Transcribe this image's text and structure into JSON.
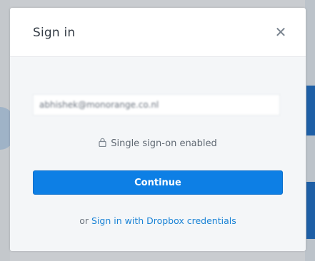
{
  "modal": {
    "title": "Sign in",
    "close_icon": "close-icon",
    "email_value": "abhishek@monorange.co.nl",
    "sso_icon": "lock-icon",
    "sso_text": "Single sign-on enabled",
    "continue_label": "Continue",
    "alt_prefix": "or",
    "alt_link": "Sign in with Dropbox credentials"
  },
  "colors": {
    "primary": "#0d7fe5",
    "link": "#1a83d6",
    "modal_body_bg": "#f4f6f8"
  }
}
